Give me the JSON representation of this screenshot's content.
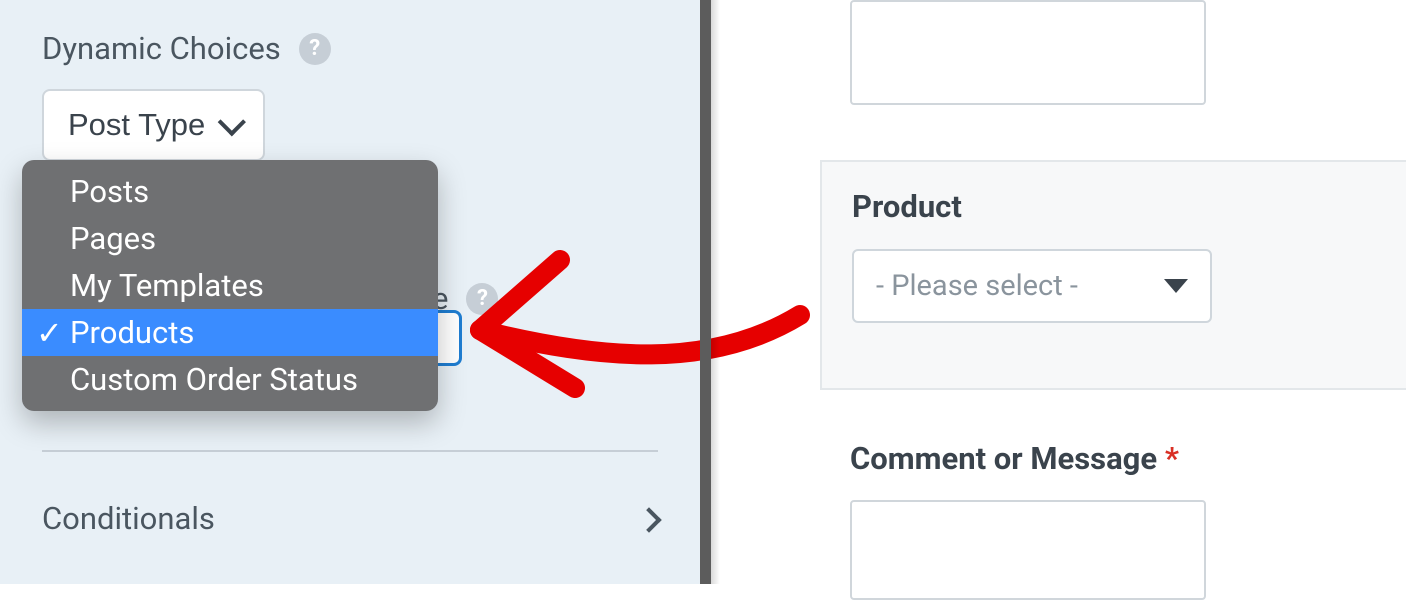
{
  "leftPanel": {
    "dynamicChoicesLabel": "Dynamic Choices",
    "postTypeButton": "Post Type",
    "secondaryPartial": "e",
    "dropdown": {
      "items": [
        {
          "label": "Posts",
          "selected": false
        },
        {
          "label": "Pages",
          "selected": false
        },
        {
          "label": "My Templates",
          "selected": false
        },
        {
          "label": "Products",
          "selected": true
        },
        {
          "label": "Custom Order Status",
          "selected": false
        }
      ]
    },
    "conditionalsLabel": "Conditionals"
  },
  "rightPanel": {
    "productLabel": "Product",
    "productPlaceholder": "- Please select -",
    "commentLabel": "Comment or Message",
    "requiredMark": "*"
  }
}
